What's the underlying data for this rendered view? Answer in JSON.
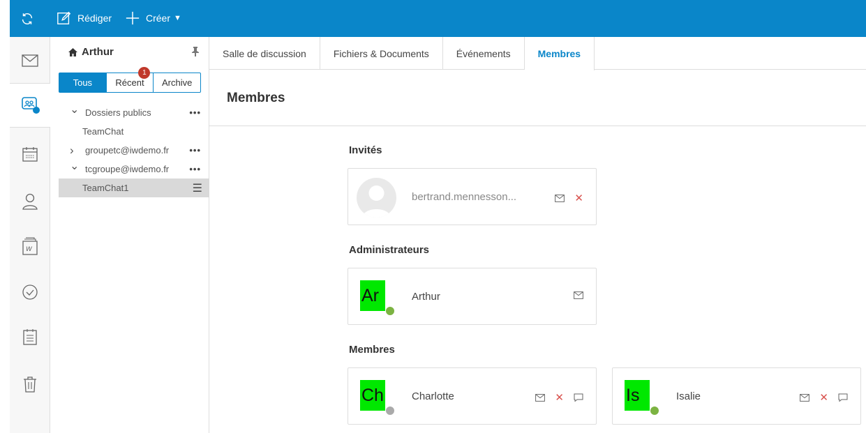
{
  "topbar": {
    "compose_label": "Rédiger",
    "create_label": "Créer"
  },
  "folders": {
    "user": "Arthur",
    "segments": [
      "Tous",
      "Récent",
      "Archive"
    ],
    "recent_badge": "1",
    "tree": [
      {
        "label": "Dossiers publics",
        "indent": 0,
        "chevron": "down",
        "menu": "•••"
      },
      {
        "label": "TeamChat",
        "indent": 1,
        "chevron": "",
        "menu": ""
      },
      {
        "label": "groupetc@iwdemo.fr",
        "indent": 0,
        "chevron": "right",
        "menu": "•••"
      },
      {
        "label": "tcgroupe@iwdemo.fr",
        "indent": 0,
        "chevron": "down",
        "menu": "•••"
      },
      {
        "label": "TeamChat1",
        "indent": 1,
        "chevron": "",
        "menu": "☰",
        "selected": true
      }
    ]
  },
  "tabs": [
    "Salle de discussion",
    "Fichiers & Documents",
    "Événements",
    "Membres"
  ],
  "active_tab": "Membres",
  "page_title": "Membres",
  "sections": {
    "guests_title": "Invités",
    "admins_title": "Administrateurs",
    "members_title": "Membres"
  },
  "guest": {
    "name": "bertrand.mennesson..."
  },
  "admin": {
    "initials": "Ar",
    "name": "Arthur",
    "presence": "#7cb342"
  },
  "members": [
    {
      "initials": "Ch",
      "name": "Charlotte",
      "presence": "#aaaaaa"
    },
    {
      "initials": "Is",
      "name": "Isalie",
      "presence": "#7cb342"
    }
  ],
  "colors": {
    "accent": "#0a86c9",
    "badge": "#c0392b",
    "remove": "#d9534f"
  }
}
